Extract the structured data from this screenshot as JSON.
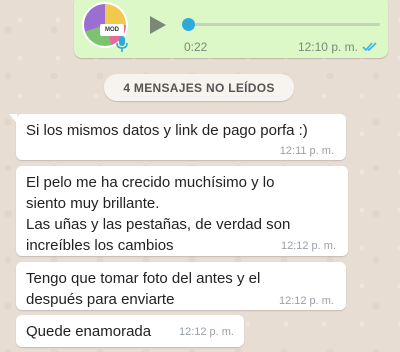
{
  "voice_message": {
    "duration": "0:22",
    "time": "12:10 p. m.",
    "avatar_logo": "MOD",
    "progress": 0.0,
    "icons": {
      "play": "play-icon",
      "mic": "mic-icon",
      "status": "double-check-icon"
    },
    "colors": {
      "bubble": "#dcf8c6",
      "thumb": "#2eaad8",
      "ticks": "#34b7f1",
      "mic": "#2eaad8"
    }
  },
  "unread_banner": {
    "label": "4 MENSAJES NO LEÍDOS"
  },
  "messages": [
    {
      "text": "Si los mismos datos y link de pago porfa :)",
      "time": "12:11 p. m."
    },
    {
      "lines": [
        "El pelo me ha crecido muchísimo y lo",
        "siento muy brillante.",
        "Las uñas y las pestañas, de verdad son",
        "increíbles los cambios"
      ],
      "time": "12:12 p. m."
    },
    {
      "lines": [
        "Tengo que tomar foto del antes y el",
        "después para enviarte"
      ],
      "time": "12:12 p. m."
    },
    {
      "text": "Quede enamorada",
      "time": "12:12 p. m."
    }
  ]
}
